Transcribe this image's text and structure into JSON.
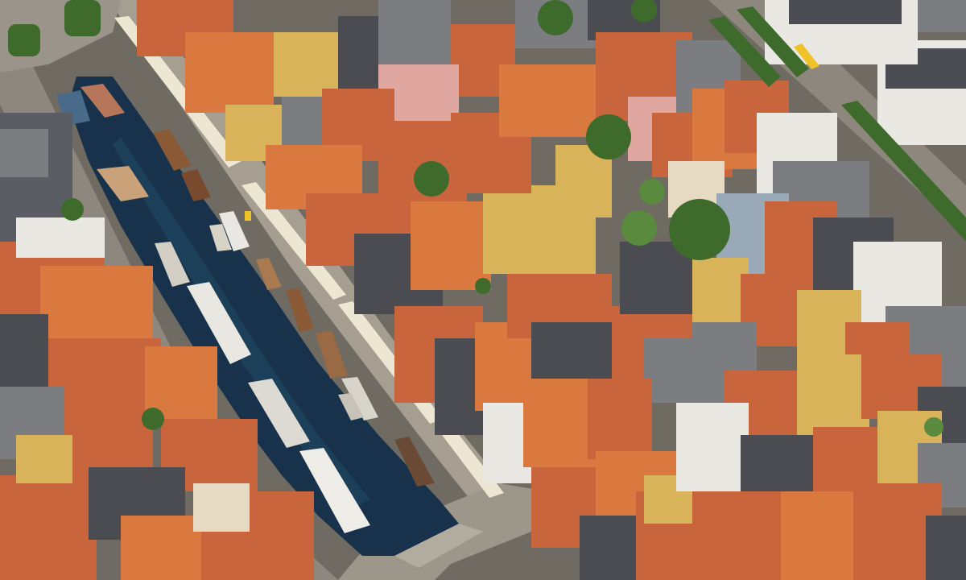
{
  "scene": {
    "subject": "aerial-photo",
    "colors": {
      "water": "#17324a",
      "water_highlight": "#24506e",
      "quay": "#8d877d",
      "quay_light": "#a59e91",
      "roof_red": "#c8653d",
      "roof_orange": "#d9793f",
      "roof_dark": "#4a4c52",
      "roof_grey": "#7b7d80",
      "facade_yellow": "#d9b35a",
      "facade_cream": "#e6dbc2",
      "facade_white": "#e9e8e2",
      "facade_pink": "#e0a7a0",
      "facade_blue": "#9aa9b8",
      "tree": "#3e6a2c",
      "tree_light": "#5a8a3d",
      "awning": "#ece6d3",
      "boat_hull": "#e9e7e1",
      "boat_wood": "#8a5a36",
      "bus": "#f0c22a"
    }
  }
}
